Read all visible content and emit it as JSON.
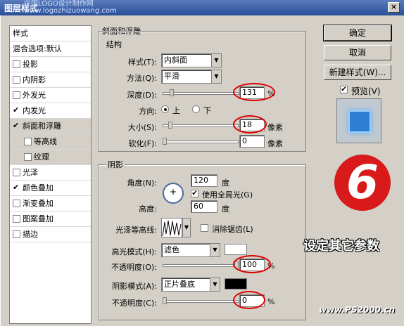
{
  "window": {
    "title": "图层样式",
    "watermark_line1": "中国LOGO设计制作网",
    "watermark_line2": "www.logozhizuowang.com",
    "close_label": "×"
  },
  "styles_list": {
    "header": "样式",
    "blend_options": "混合选项:默认",
    "items": [
      {
        "label": "投影",
        "checked": false
      },
      {
        "label": "内阴影",
        "checked": false
      },
      {
        "label": "外发光",
        "checked": false
      },
      {
        "label": "内发光",
        "checked": true
      },
      {
        "label": "斜面和浮雕",
        "checked": true
      },
      {
        "label": "等高线",
        "checked": false
      },
      {
        "label": "纹理",
        "checked": false
      },
      {
        "label": "光泽",
        "checked": false
      },
      {
        "label": "颜色叠加",
        "checked": true
      },
      {
        "label": "渐变叠加",
        "checked": false
      },
      {
        "label": "图案叠加",
        "checked": false
      },
      {
        "label": "描边",
        "checked": false
      }
    ],
    "check_glyph": "✔"
  },
  "bevel": {
    "section_title": "斜面和浮雕",
    "structure_title": "结构",
    "style_label": "样式(T):",
    "style_value": "内斜面",
    "technique_label": "方法(Q):",
    "technique_value": "平滑",
    "depth_label": "深度(D):",
    "depth_value": "131",
    "depth_unit": "%",
    "direction_label": "方向:",
    "direction_up": "上",
    "direction_down": "下",
    "size_label": "大小(S):",
    "size_value": "18",
    "size_unit": "像素",
    "soften_label": "软化(F):",
    "soften_value": "0",
    "soften_unit": "像素"
  },
  "shading": {
    "title": "阴影",
    "angle_label": "角度(N):",
    "angle_value": "120",
    "angle_unit": "度",
    "global_light_label": "使用全局光(G)",
    "altitude_label": "高度:",
    "altitude_value": "60",
    "altitude_unit": "度",
    "gloss_contour_label": "光泽等高线:",
    "anti_alias_label": "消除锯齿(L)",
    "highlight_mode_label": "高光模式(H):",
    "highlight_mode_value": "滤色",
    "highlight_opacity_label": "不透明度(O):",
    "highlight_opacity_value": "100",
    "highlight_opacity_unit": "%",
    "shadow_mode_label": "阴影模式(A):",
    "shadow_mode_value": "正片叠底",
    "shadow_opacity_label": "不透明度(C):",
    "shadow_opacity_value": "0",
    "shadow_opacity_unit": "%",
    "highlight_color": "#ffffff",
    "shadow_color": "#000000"
  },
  "buttons": {
    "ok": "确定",
    "cancel": "取消",
    "new_style": "新建样式(W)...",
    "preview": "预览(V)"
  },
  "annotation": {
    "step_number": "6",
    "caption": "设定其它参数",
    "site": "www.PS2000.cn"
  }
}
